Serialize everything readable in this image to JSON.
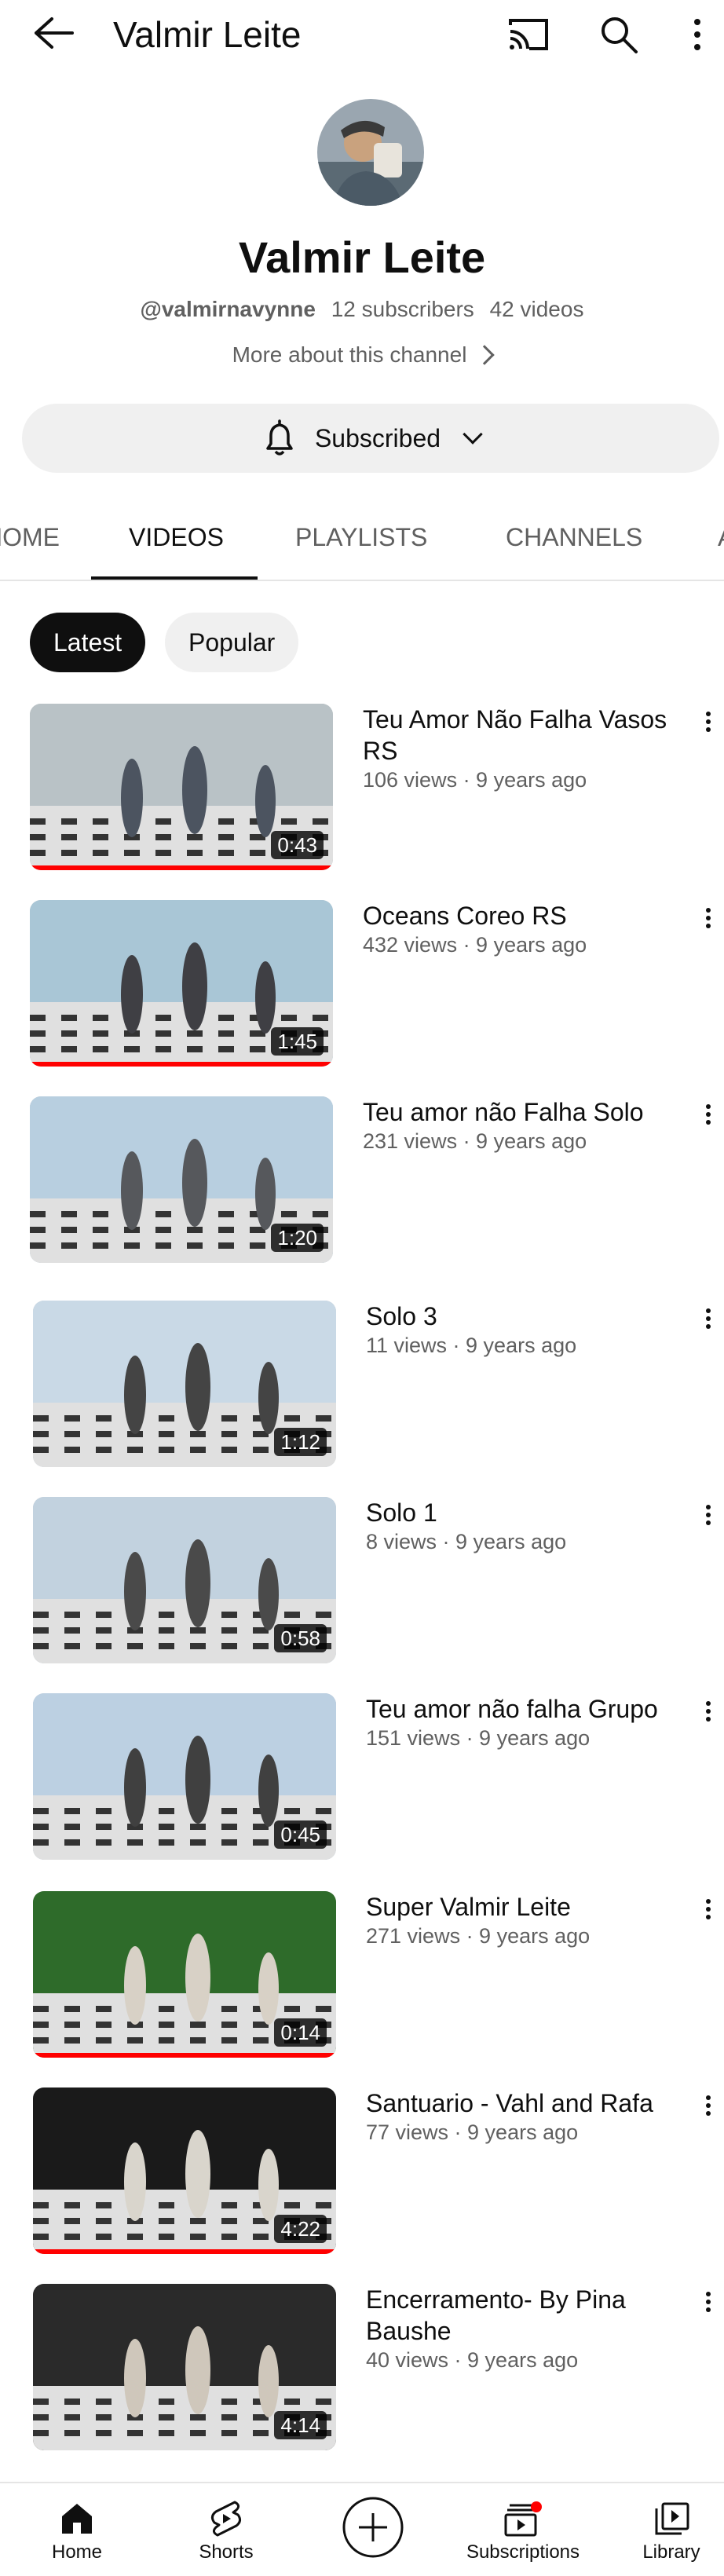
{
  "topbar": {
    "title": "Valmir Leite",
    "icons": [
      "back-arrow-icon",
      "cast-icon",
      "search-icon",
      "more-vert-icon"
    ]
  },
  "channel": {
    "name": "Valmir Leite",
    "handle": "@valmirnavynne",
    "subscribers": "12 subscribers",
    "videos": "42 videos",
    "about": "More about this channel",
    "subscribe_label": "Subscribed"
  },
  "tabs": [
    {
      "label": "HOME",
      "active": false
    },
    {
      "label": "VIDEOS",
      "active": true
    },
    {
      "label": "PLAYLISTS",
      "active": false
    },
    {
      "label": "CHANNELS",
      "active": false
    },
    {
      "label": "A",
      "active": false
    }
  ],
  "chips": [
    {
      "label": "Latest",
      "active": true
    },
    {
      "label": "Popular",
      "active": false
    }
  ],
  "videos": [
    {
      "title": "Teu Amor Não Falha Vasos RS",
      "meta": "106 views · 9 years ago",
      "duration": "0:43",
      "watched": true
    },
    {
      "title": "Oceans Coreo RS",
      "meta": "432 views · 9 years ago",
      "duration": "1:45",
      "watched": true
    },
    {
      "title": "Teu amor não Falha   Solo",
      "meta": "231 views · 9 years ago",
      "duration": "1:20",
      "watched": false
    },
    {
      "title": "Solo 3",
      "meta": "11 views · 9 years ago",
      "duration": "1:12",
      "watched": false
    },
    {
      "title": "Solo 1",
      "meta": "8 views · 9 years ago",
      "duration": "0:58",
      "watched": false
    },
    {
      "title": "Teu amor não falha   Grupo",
      "meta": "151 views · 9 years ago",
      "duration": "0:45",
      "watched": false
    },
    {
      "title": "Super Valmir Leite",
      "meta": "271 views · 9 years ago",
      "duration": "0:14",
      "watched": true
    },
    {
      "title": "Santuario  - Vahl and Rafa",
      "meta": "77 views · 9 years ago",
      "duration": "4:22",
      "watched": true
    },
    {
      "title": "Encerramento- By Pina Baushe",
      "meta": "40 views · 9 years ago",
      "duration": "4:14",
      "watched": false
    }
  ],
  "bottomnav": [
    {
      "label": "Home",
      "icon": "home-icon"
    },
    {
      "label": "Shorts",
      "icon": "shorts-icon"
    },
    {
      "label": "",
      "icon": "create-plus-icon"
    },
    {
      "label": "Subscriptions",
      "icon": "subscriptions-icon"
    },
    {
      "label": "Library",
      "icon": "library-icon"
    }
  ],
  "colors": {
    "accent": "#ff0000",
    "text": "#0f0f0f",
    "secondary": "#606060",
    "chip": "#f0f0f0"
  }
}
